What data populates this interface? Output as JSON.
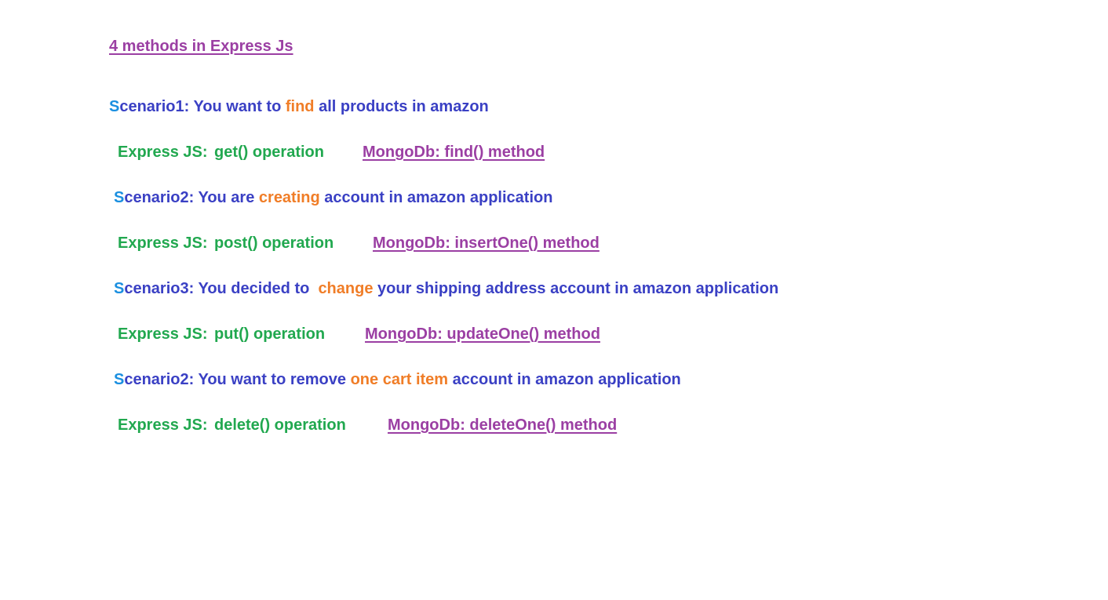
{
  "title": "4 methods in Express Js",
  "scenarios": [
    {
      "first_letter": "S",
      "pre": "cenario1: You want to ",
      "highlight": "find",
      "post": " all products in amazon",
      "express_label": "Express JS:",
      "express_op": "get() operation",
      "mongo": "MongoDb: find() method"
    },
    {
      "first_letter": "S",
      "pre": "cenario2: You are ",
      "highlight": "creating",
      "post": " account in amazon application",
      "express_label": "Express JS:",
      "express_op": "post() operation",
      "mongo": "MongoDb: insertOne() method"
    },
    {
      "first_letter": "S",
      "pre": "cenario3: You decided to  ",
      "highlight": "change",
      "post": " your shipping address account in amazon application",
      "express_label": "Express JS:",
      "express_op": "put() operation",
      "mongo": "MongoDb: updateOne() method"
    },
    {
      "first_letter": "S",
      "pre": "cenario2: You want to remove ",
      "highlight": "one cart item",
      "post": " account in amazon application",
      "express_label": "Express JS:",
      "express_op": "delete() operation",
      "mongo": "MongoDb: deleteOne() method"
    }
  ],
  "colors": {
    "title": "#9b3fa3",
    "scenario_text": "#3a40c4",
    "scenario_first_letter": "#1a8fe0",
    "highlight": "#f07d27",
    "express": "#21a84f",
    "mongo": "#9b3fa3"
  }
}
